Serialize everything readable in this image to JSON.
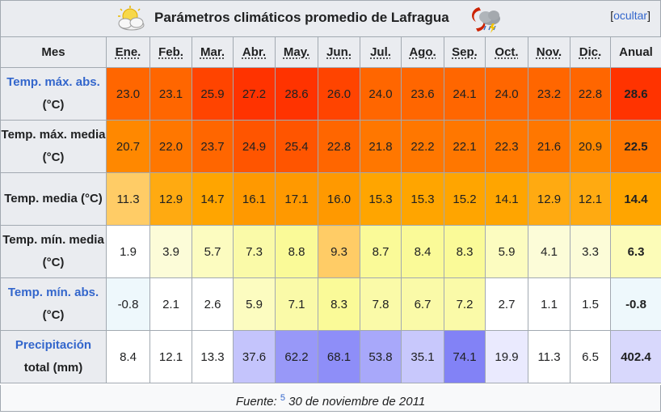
{
  "title": "Parámetros climáticos promedio de Lafragua",
  "hide": {
    "bracket_open": "[",
    "link": "ocultar",
    "bracket_close": "]"
  },
  "header": {
    "mes": "Mes",
    "months": [
      "Ene.",
      "Feb.",
      "Mar.",
      "Abr.",
      "May.",
      "Jun.",
      "Jul.",
      "Ago.",
      "Sep.",
      "Oct.",
      "Nov.",
      "Dic."
    ],
    "anual": "Anual"
  },
  "rows": [
    {
      "label_link": "Temp. máx. abs.",
      "label_rest": " (°C)",
      "linked": true,
      "values": [
        "23.0",
        "23.1",
        "25.9",
        "27.2",
        "28.6",
        "26.0",
        "24.0",
        "23.6",
        "24.1",
        "24.0",
        "23.2",
        "22.8"
      ],
      "anual": "28.6",
      "colors": [
        "#ff6600",
        "#ff6600",
        "#ff4400",
        "#ff3300",
        "#ff3300",
        "#ff4400",
        "#ff6600",
        "#ff6600",
        "#ff6600",
        "#ff6600",
        "#ff6600",
        "#ff6600"
      ],
      "anual_color": "#ff3300"
    },
    {
      "label_link": "Temp. máx. media (°C)",
      "label_rest": "",
      "linked": false,
      "values": [
        "20.7",
        "22.0",
        "23.7",
        "24.9",
        "25.4",
        "22.8",
        "21.8",
        "22.2",
        "22.1",
        "22.3",
        "21.6",
        "20.9"
      ],
      "anual": "22.5",
      "colors": [
        "#ff8800",
        "#ff7700",
        "#ff6600",
        "#ff5500",
        "#ff5500",
        "#ff6600",
        "#ff7700",
        "#ff7700",
        "#ff7700",
        "#ff7700",
        "#ff7700",
        "#ff8800"
      ],
      "anual_color": "#ff7700"
    },
    {
      "label_link": "Temp. media (°C)",
      "label_rest": "",
      "linked": false,
      "values": [
        "11.3",
        "12.9",
        "14.7",
        "16.1",
        "17.1",
        "16.0",
        "15.3",
        "15.3",
        "15.2",
        "14.1",
        "12.9",
        "12.1"
      ],
      "anual": "14.4",
      "colors": [
        "#ffcc66",
        "#ffaa11",
        "#ffa500",
        "#ff9900",
        "#ff9900",
        "#ff9900",
        "#ffa500",
        "#ffa500",
        "#ffa500",
        "#ffa500",
        "#ffaa11",
        "#ffaa11"
      ],
      "anual_color": "#ffa500"
    },
    {
      "label_link": "Temp. mín. media (°C)",
      "label_rest": "",
      "linked": false,
      "values": [
        "1.9",
        "3.9",
        "5.7",
        "7.3",
        "8.8",
        "9.3",
        "8.7",
        "8.4",
        "8.3",
        "5.9",
        "4.1",
        "3.3"
      ],
      "anual": "6.3",
      "colors": [
        "#ffffff",
        "#fcfcd8",
        "#fcfcc0",
        "#fafaa8",
        "#fafa98",
        "#ffcc66",
        "#fafa98",
        "#fafa98",
        "#fafa98",
        "#fcfcc0",
        "#fcfcd8",
        "#fcfcd8"
      ],
      "anual_color": "#fcfcb8"
    },
    {
      "label_link": "Temp. mín. abs.",
      "label_rest": " (°C)",
      "linked": true,
      "values": [
        "-0.8",
        "2.1",
        "2.6",
        "5.9",
        "7.1",
        "8.3",
        "7.8",
        "6.7",
        "7.2",
        "2.7",
        "1.1",
        "1.5"
      ],
      "anual": "-0.8",
      "colors": [
        "#eef8fc",
        "#ffffff",
        "#ffffff",
        "#fcfcc0",
        "#fafaa8",
        "#fafa98",
        "#fafaa8",
        "#fafaa8",
        "#fafaa8",
        "#ffffff",
        "#ffffff",
        "#ffffff"
      ],
      "anual_color": "#eef8fc"
    },
    {
      "label_link": "Precipitación",
      "label_rest": " total (mm)",
      "linked": true,
      "values": [
        "8.4",
        "12.1",
        "13.3",
        "37.6",
        "62.2",
        "68.1",
        "53.8",
        "35.1",
        "74.1",
        "19.9",
        "11.3",
        "6.5"
      ],
      "anual": "402.4",
      "colors": [
        "#ffffff",
        "#ffffff",
        "#ffffff",
        "#c4c4fc",
        "#9898f8",
        "#8e8ef8",
        "#a8a8fa",
        "#c8c8fc",
        "#8282f6",
        "#eaeafe",
        "#ffffff",
        "#ffffff"
      ],
      "anual_color": "#d8d8fc"
    }
  ],
  "footer": {
    "prefix": "Fuente:",
    "ref": "5",
    "date": "30 de noviembre de 2011"
  }
}
